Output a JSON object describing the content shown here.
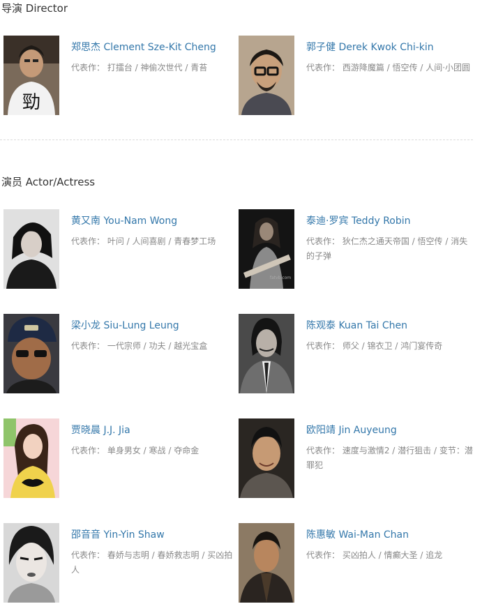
{
  "director_section": {
    "title": "导演 Director",
    "people": [
      {
        "name": "郑思杰 Clement Sze-Kit Cheng",
        "works_label": "代表作：",
        "works": [
          "打擂台",
          "神偷次世代",
          "青苔"
        ]
      },
      {
        "name": "郭子健 Derek Kwok Chi-kin",
        "works_label": "代表作：",
        "works": [
          "西游降魔篇",
          "悟空传",
          "人间·小团圆"
        ]
      }
    ]
  },
  "actor_section": {
    "title": "演员 Actor/Actress",
    "people": [
      {
        "name": "黄又南 You-Nam Wong",
        "works_label": "代表作：",
        "works": [
          "叶问",
          "人间喜剧",
          "青春梦工场"
        ]
      },
      {
        "name": "泰迪·罗宾 Teddy Robin",
        "works_label": "代表作：",
        "works": [
          "狄仁杰之通天帝国",
          "悟空传",
          "消失的子弹"
        ]
      },
      {
        "name": "梁小龙 Siu-Lung Leung",
        "works_label": "代表作：",
        "works": [
          "一代宗师",
          "功夫",
          "越光宝盒"
        ]
      },
      {
        "name": "陈观泰 Kuan Tai Chen",
        "works_label": "代表作：",
        "works": [
          "师父",
          "锦衣卫",
          "鸿门宴传奇"
        ]
      },
      {
        "name": "贾晓晨 J.J. Jia",
        "works_label": "代表作：",
        "works": [
          "单身男女",
          "寒战",
          "夺命金"
        ]
      },
      {
        "name": "欧阳靖 Jin Auyeung",
        "works_label": "代表作：",
        "works": [
          "速度与激情2",
          "潜行狙击",
          "变节：潜罪犯"
        ]
      },
      {
        "name": "邵音音 Yin-Yin Shaw",
        "works_label": "代表作：",
        "works": [
          "春娇与志明",
          "春娇救志明",
          "买凶拍人"
        ]
      },
      {
        "name": "陈惠敏 Wai-Man Chan",
        "works_label": "代表作：",
        "works": [
          "买凶拍人",
          "情癫大圣",
          "追龙"
        ]
      }
    ]
  }
}
